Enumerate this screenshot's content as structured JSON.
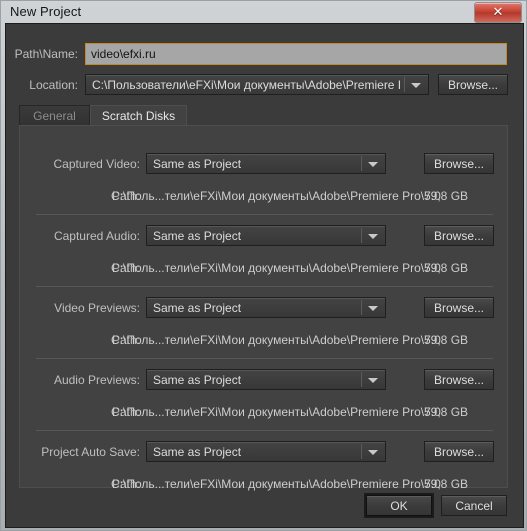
{
  "window": {
    "title": "New Project",
    "close_icon": "close-icon",
    "close_glyph": "✕"
  },
  "form": {
    "path_name": {
      "label": "Path\\Name:",
      "value": "video\\efxi.ru"
    },
    "location": {
      "label": "Location:",
      "value": "C:\\Пользователи\\eFXi\\Мои документы\\Adobe\\Premiere Pr...",
      "browse_label": "Browse..."
    }
  },
  "tabs": [
    {
      "label": "General",
      "active": false
    },
    {
      "label": "Scratch Disks",
      "active": true
    }
  ],
  "scratch_disks": {
    "path_label": "Path:",
    "browse_label": "Browse...",
    "rows": [
      {
        "label": "Captured Video:",
        "value": "Same as Project",
        "path": "C:\\Поль...тели\\eFXi\\Мои документы\\Adobe\\Premiere Pro\\7.0",
        "size": "59,8 GB"
      },
      {
        "label": "Captured Audio:",
        "value": "Same as Project",
        "path": "C:\\Поль...тели\\eFXi\\Мои документы\\Adobe\\Premiere Pro\\7.0",
        "size": "59,8 GB"
      },
      {
        "label": "Video Previews:",
        "value": "Same as Project",
        "path": "C:\\Поль...тели\\eFXi\\Мои документы\\Adobe\\Premiere Pro\\7.0",
        "size": "59,8 GB"
      },
      {
        "label": "Audio Previews:",
        "value": "Same as Project",
        "path": "C:\\Поль...тели\\eFXi\\Мои документы\\Adobe\\Premiere Pro\\7.0",
        "size": "59,8 GB"
      },
      {
        "label": "Project Auto Save:",
        "value": "Same as Project",
        "path": "C:\\Поль...тели\\eFXi\\Мои документы\\Adobe\\Premiere Pro\\7.0",
        "size": "59,8 GB"
      }
    ]
  },
  "footer": {
    "ok_label": "OK",
    "cancel_label": "Cancel"
  },
  "colors": {
    "dialog_bg": "#3b3b3b",
    "panel_bg": "#424242",
    "focus_border": "#c68a1e",
    "close_red": "#c54032",
    "text": "#dcdcdc"
  }
}
